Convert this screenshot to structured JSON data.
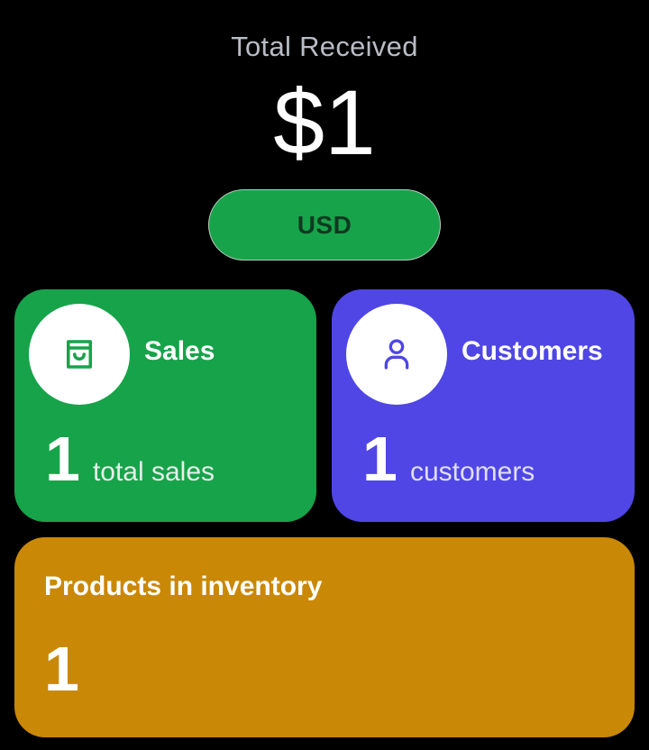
{
  "summary": {
    "label": "Total Received",
    "amount": "$1",
    "currency": "USD"
  },
  "cards": {
    "sales": {
      "title": "Sales",
      "value": "1",
      "unit": "total sales",
      "icon": "shopping-bag-icon",
      "color": "#17a34a"
    },
    "customers": {
      "title": "Customers",
      "value": "1",
      "unit": "customers",
      "icon": "user-icon",
      "color": "#4f46e5"
    },
    "inventory": {
      "title": "Products in inventory",
      "value": "1",
      "color": "#c98806"
    }
  }
}
